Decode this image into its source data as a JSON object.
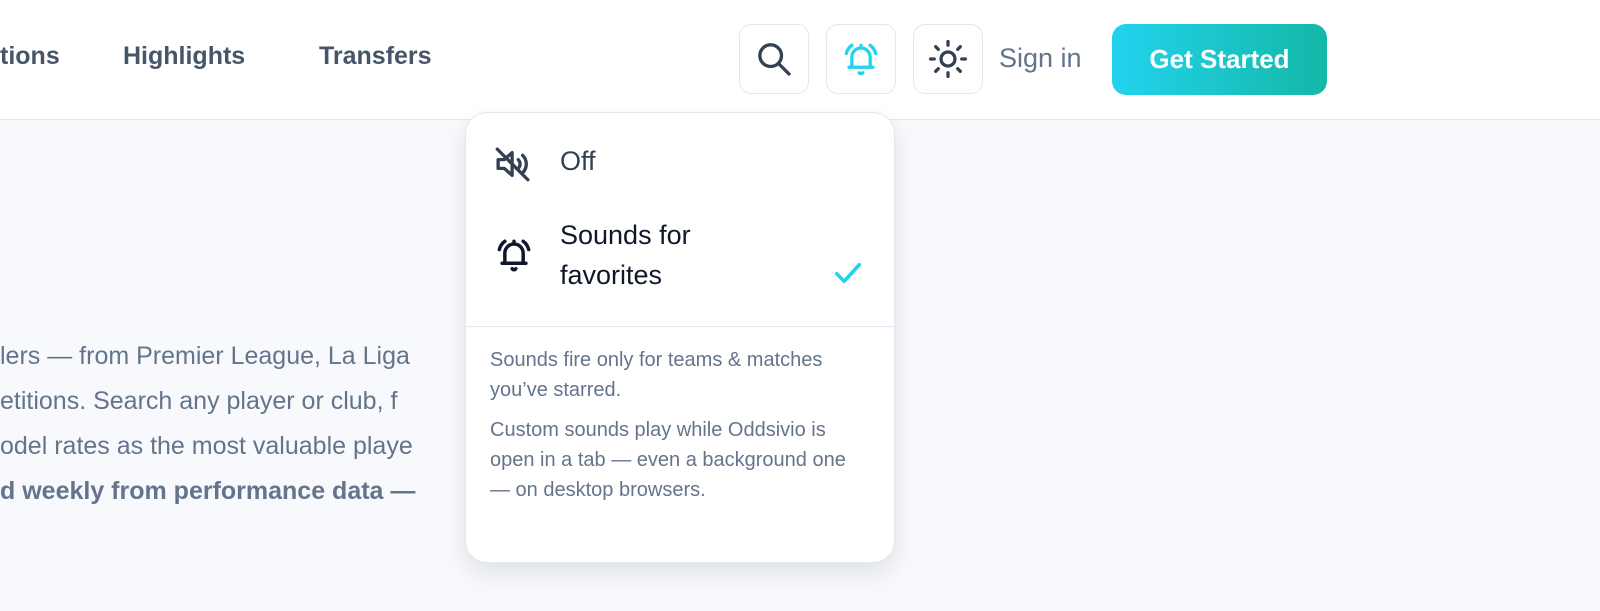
{
  "nav": {
    "links": [
      "tions",
      "Highlights",
      "Transfers"
    ]
  },
  "header": {
    "sign_in": "Sign in",
    "cta": "Get Started",
    "icons": [
      "search-icon",
      "bell-ringing-icon",
      "sun-icon"
    ],
    "accent_color": "#22d3ee"
  },
  "content": {
    "lines": [
      "lers — from Premier League, La Liga",
      "etitions. Search any player or club, f",
      "odel rates as the most valuable playe",
      "d weekly from performance data —"
    ]
  },
  "sound_menu": {
    "options": [
      {
        "label": "Off",
        "icon": "sound-off-icon",
        "selected": false
      },
      {
        "label": "Sounds for favorites",
        "icon": "bell-ringing-icon",
        "selected": true
      }
    ],
    "notes": [
      "Sounds fire only for teams & matches you’ve starred.",
      "Custom sounds play while Oddsivio is open in a tab — even a background one — on desktop browsers."
    ]
  }
}
